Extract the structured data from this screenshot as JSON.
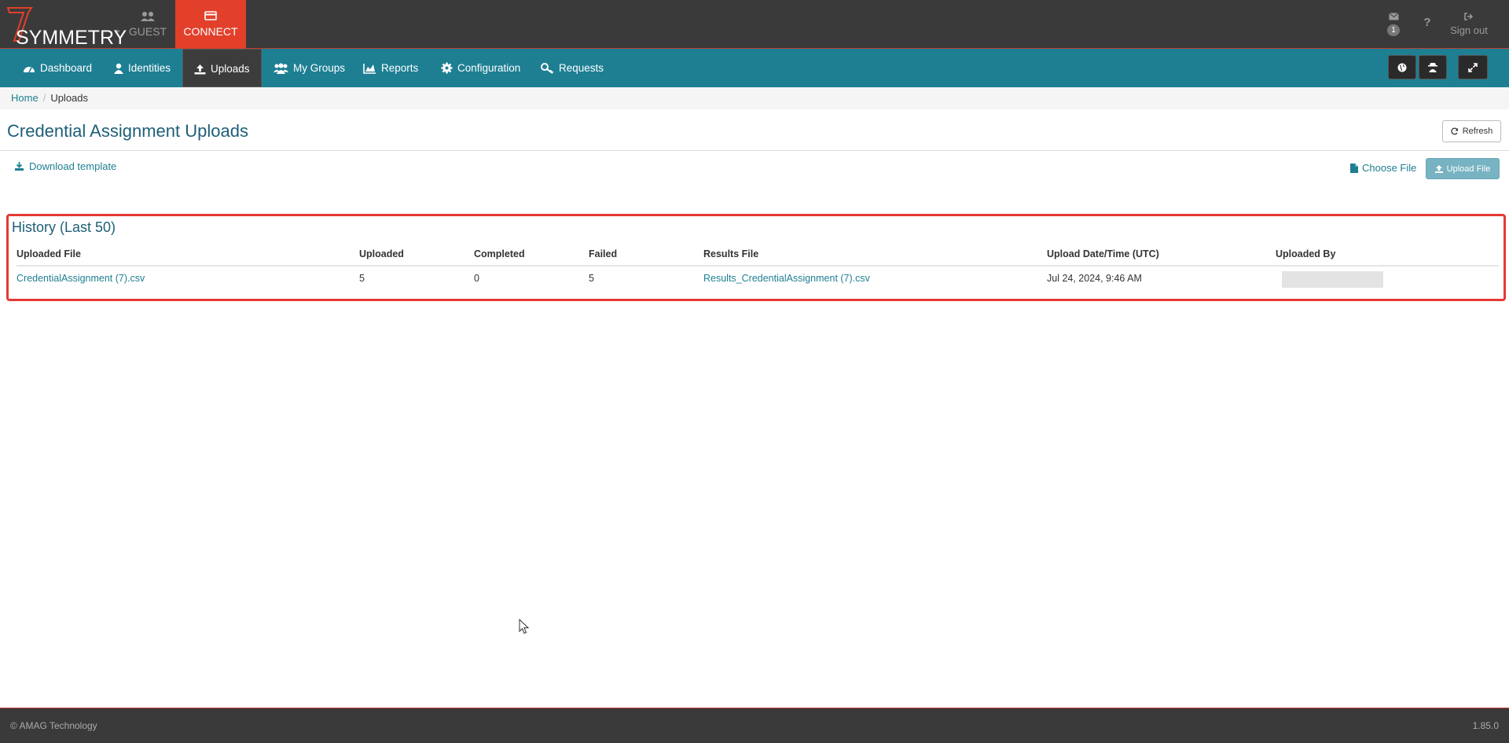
{
  "brand": {
    "name": "SYMMETRY",
    "tm": "™"
  },
  "modes": [
    {
      "label": "GUEST",
      "icon": "users-icon"
    },
    {
      "label": "CONNECT",
      "icon": "card-icon",
      "active": true
    }
  ],
  "top_right": {
    "mail_count": "1",
    "help_label": "?",
    "signout_label": "Sign out"
  },
  "nav": [
    {
      "label": "Dashboard",
      "icon": "dashboard-icon"
    },
    {
      "label": "Identities",
      "icon": "user-icon"
    },
    {
      "label": "Uploads",
      "icon": "upload-icon",
      "active": true
    },
    {
      "label": "My Groups",
      "icon": "groups-icon"
    },
    {
      "label": "Reports",
      "icon": "chart-icon"
    },
    {
      "label": "Configuration",
      "icon": "gear-icon"
    },
    {
      "label": "Requests",
      "icon": "key-icon"
    }
  ],
  "breadcrumb": {
    "home": "Home",
    "current": "Uploads"
  },
  "page": {
    "title": "Credential Assignment Uploads",
    "refresh_label": "Refresh",
    "download_template_label": "Download template",
    "choose_file_label": "Choose File",
    "upload_file_label": "Upload File"
  },
  "history": {
    "title": "History (Last 50)",
    "columns": [
      "Uploaded File",
      "Uploaded",
      "Completed",
      "Failed",
      "Results File",
      "Upload Date/Time (UTC)",
      "Uploaded By"
    ],
    "rows": [
      {
        "uploaded_file": "CredentialAssignment (7).csv",
        "uploaded": "5",
        "completed": "0",
        "failed": "5",
        "results_file": "Results_CredentialAssignment (7).csv",
        "upload_datetime": "Jul 24, 2024, 9:46 AM",
        "uploaded_by": ""
      }
    ]
  },
  "footer": {
    "copyright": "© AMAG Technology",
    "version": "1.85.0"
  },
  "colors": {
    "topbar": "#3a3a3a",
    "nav": "#1e7f93",
    "connect": "#e2402b",
    "highlight_border": "#e53935"
  }
}
